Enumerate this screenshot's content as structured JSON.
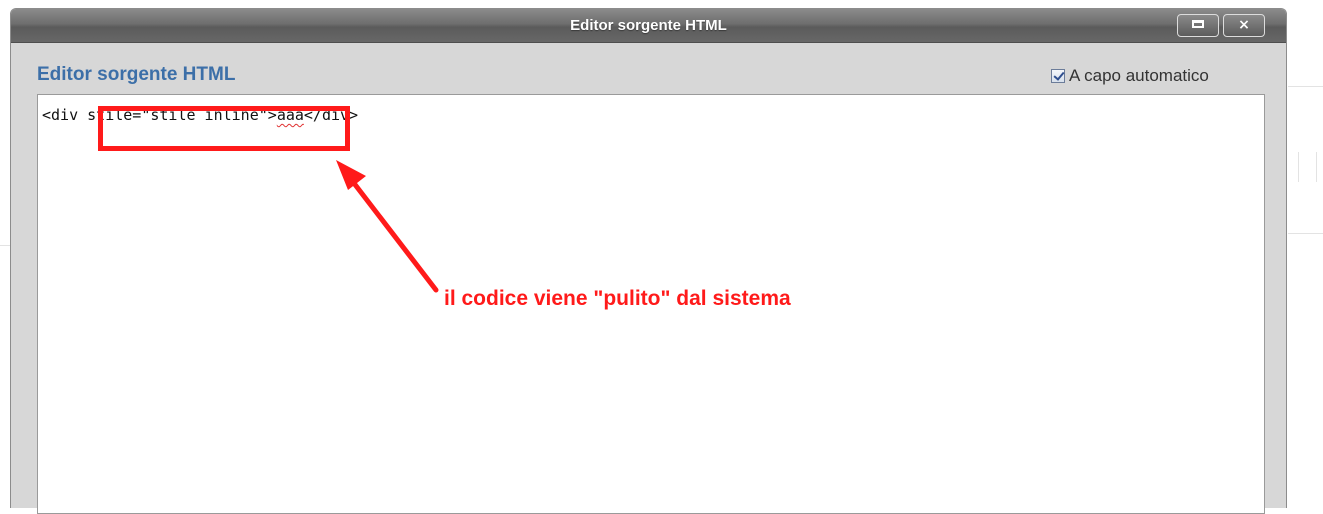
{
  "dialog": {
    "title": "Editor sorgente HTML",
    "panel_title": "Editor sorgente HTML",
    "wrap_label": "A capo automatico",
    "wrap_checked": true,
    "window_buttons": {
      "maximize": "maximize-icon",
      "close": "×"
    }
  },
  "editor": {
    "code_before": "<div ",
    "code_attr": "stile=\"stile inline\"",
    "code_gt": ">",
    "code_misspelled": "aaa",
    "code_after": "</div>"
  },
  "annotation": {
    "text": "il codice viene \"pulito\" dal sistema",
    "color": "#ff1a1a"
  },
  "colors": {
    "panel_title": "#3c6fa8",
    "titlebar": "#6e6e6e",
    "dialog_bg": "#d7d7d7"
  }
}
